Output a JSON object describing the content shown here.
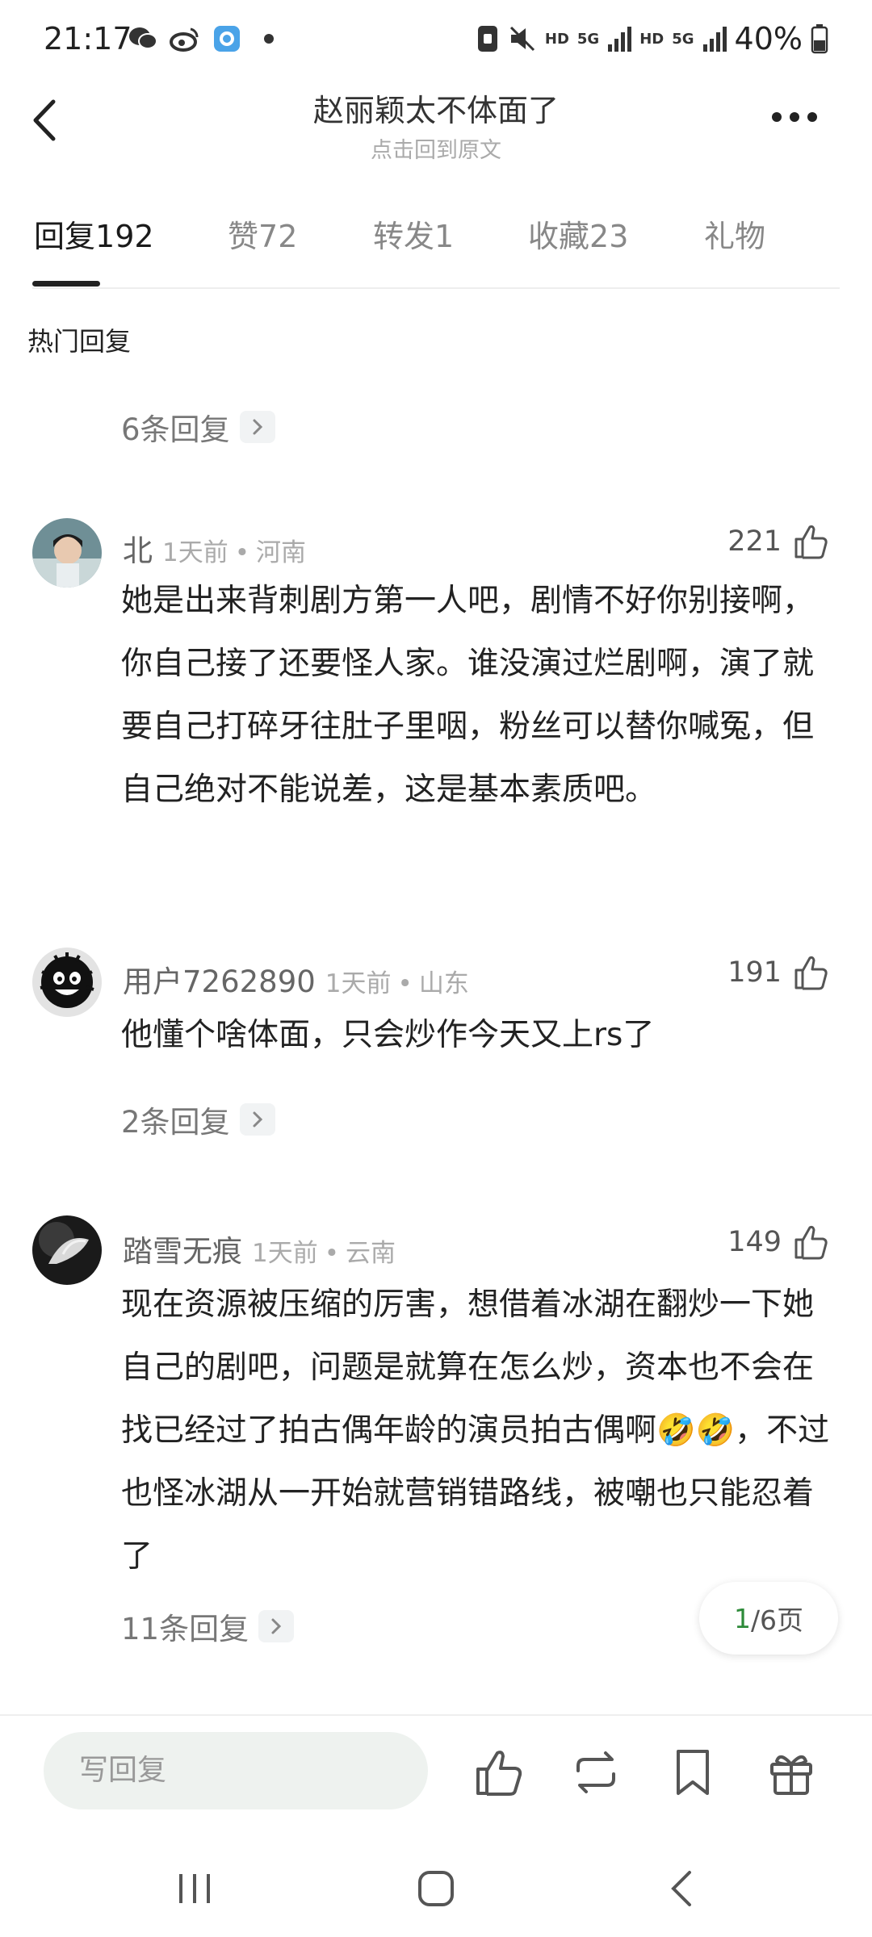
{
  "status_bar": {
    "time": "21:17",
    "battery": "40%",
    "hd_label_1": "HD",
    "g_label_1": "5G",
    "hd_label_2": "HD",
    "g_label_2": "5G",
    "icons": [
      "wechat-icon",
      "weibo-icon",
      "browser-icon",
      "dot-icon",
      "sim-icon",
      "mute-icon",
      "signal-icon",
      "battery-icon"
    ]
  },
  "header": {
    "title": "赵丽颖太不体面了",
    "subtitle": "点击回到原文"
  },
  "tabs": [
    {
      "label": "回复",
      "count": "192"
    },
    {
      "label": "赞",
      "count": "72"
    },
    {
      "label": "转发",
      "count": "1"
    },
    {
      "label": "收藏",
      "count": "23"
    },
    {
      "label": "礼物",
      "count": ""
    }
  ],
  "section_label": "热门回复",
  "top_replies_link": "6条回复",
  "comments": [
    {
      "user": "北",
      "time": "1天前",
      "location": "河南",
      "likes": "221",
      "text": "她是出来背刺剧方第一人吧，剧情不好你别接啊，你自己接了还要怪人家。谁没演过烂剧啊，演了就要自己打碎牙往肚子里咽，粉丝可以替你喊冤，但自己绝对不能说差，这是基本素质吧。"
    },
    {
      "user": "用户7262890",
      "time": "1天前",
      "location": "山东",
      "likes": "191",
      "text": "他懂个啥体面，只会炒作今天又上rs了",
      "replies": "2条回复"
    },
    {
      "user": "踏雪无痕",
      "time": "1天前",
      "location": "云南",
      "likes": "149",
      "text": "现在资源被压缩的厉害，想借着冰湖在翻炒一下她自己的剧吧，问题是就算在怎么炒，资本也不会在找已经过了拍古偶年龄的演员拍古偶啊🤣🤣，不过也怪冰湖从一开始就营销错路线，被嘲也只能忍着了",
      "replies": "11条回复"
    }
  ],
  "pagination": {
    "current": "1",
    "total": "/6页"
  },
  "bottom_bar": {
    "reply_placeholder": "写回复"
  },
  "colors": {
    "accent_green": "#2e8b3a",
    "input_bg": "#eef2ef"
  }
}
